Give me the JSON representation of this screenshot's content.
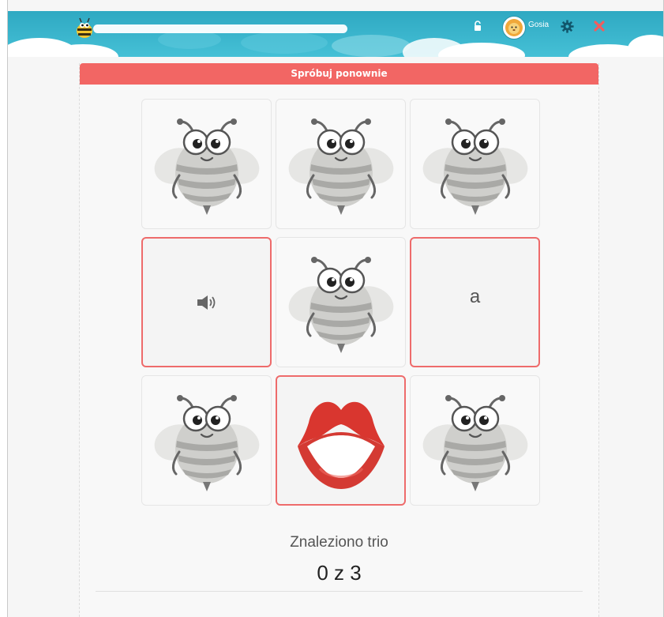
{
  "header": {
    "progress_percent": 0,
    "username": "Gosia",
    "icons": {
      "logo": "bee-logo-icon",
      "unlock": "unlock-icon",
      "avatar": "lion-avatar-icon",
      "settings": "gear-icon",
      "close": "close-icon"
    }
  },
  "banner": {
    "text": "Spróbuj ponownie"
  },
  "cards": [
    {
      "state": "hidden",
      "icon": "bee-icon"
    },
    {
      "state": "hidden",
      "icon": "bee-icon"
    },
    {
      "state": "hidden",
      "icon": "bee-icon"
    },
    {
      "state": "open",
      "icon": "speaker-icon"
    },
    {
      "state": "hidden",
      "icon": "bee-icon"
    },
    {
      "state": "open",
      "text": "a"
    },
    {
      "state": "hidden",
      "icon": "bee-icon"
    },
    {
      "state": "open",
      "icon": "lips-icon"
    },
    {
      "state": "hidden",
      "icon": "bee-icon"
    }
  ],
  "status": {
    "label": "Znaleziono trio",
    "count": "0 z 3"
  },
  "colors": {
    "banner": "#f26664",
    "card_open_border": "#ee6b6b",
    "header": "#3bb6cd"
  }
}
